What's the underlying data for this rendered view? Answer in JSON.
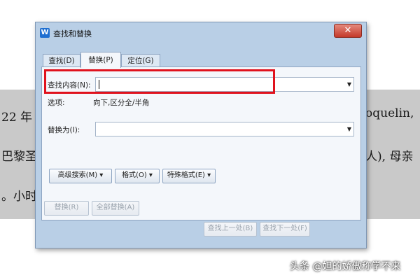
{
  "background_doc": {
    "line1_left": "22 年",
    "line1_right": "oquelin,",
    "line2_left": "巴黎圣",
    "line2_right": "人), 母亲",
    "line3_left": "。小时"
  },
  "dialog": {
    "title": "查找和替换",
    "app_logo": "W",
    "close_symbol": "✕",
    "tabs": [
      {
        "label": "查找(D)"
      },
      {
        "label": "替换(P)"
      },
      {
        "label": "定位(G)"
      }
    ],
    "find_label": "查找内容(N):",
    "find_value": "",
    "options_label": "选项:",
    "options_value": "向下,区分全/半角",
    "replace_label": "替换为(I):",
    "replace_value": "",
    "dropdown_arrow": "▼",
    "buttons": {
      "advanced": "高级搜索(M) ▾",
      "format": "格式(O) ▾",
      "special": "特殊格式(E) ▾",
      "replace": "替换(R)",
      "replace_all": "全部替换(A)",
      "find_prev": "查找上一处(B)",
      "find_next": "查找下一处(F)"
    }
  },
  "watermark": "头条 @妲的娇傲称学不来",
  "colors": {
    "highlight": "#e0121d",
    "dialog_frame": "#b9cfe6",
    "doc_band": "#c9c9c9"
  }
}
